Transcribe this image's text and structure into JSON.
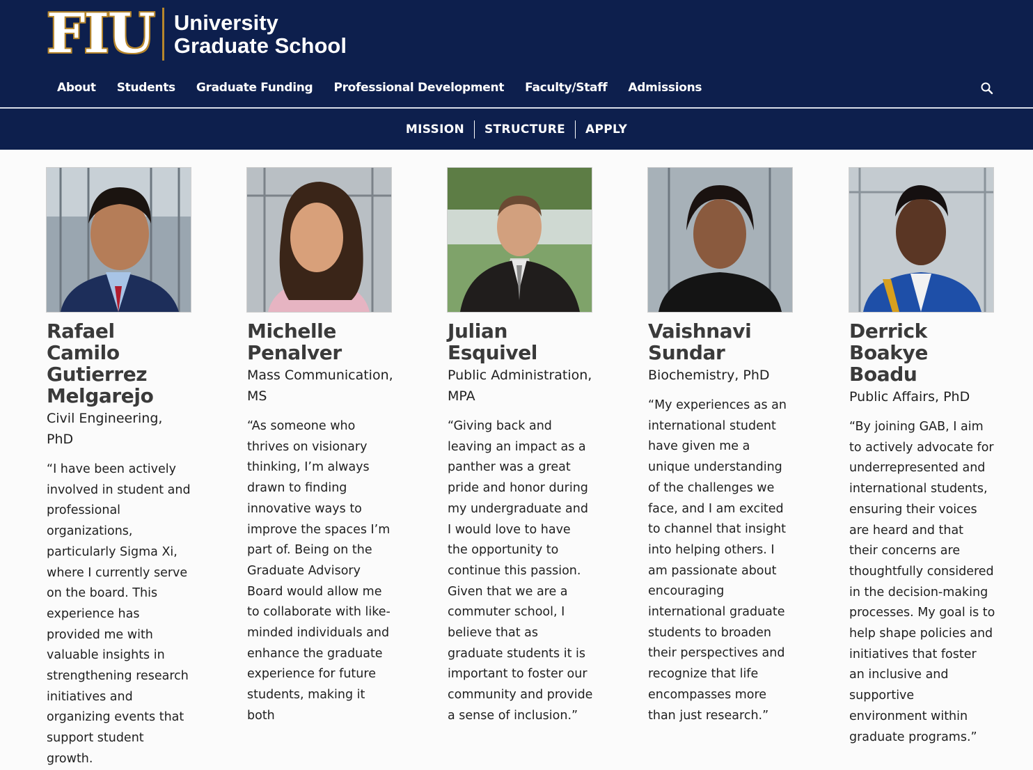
{
  "header": {
    "logo_mark": "FIU",
    "logo_line1": "University",
    "logo_line2": "Graduate School",
    "nav": [
      "About",
      "Students",
      "Graduate Funding",
      "Professional Development",
      "Faculty/Staff",
      "Admissions"
    ],
    "search_icon": "search-icon"
  },
  "subnav": [
    "MISSION",
    "STRUCTURE",
    "APPLY"
  ],
  "colors": {
    "navy": "#0d1f4d",
    "gold": "#b6862c"
  },
  "members": [
    {
      "name": "Rafael Camilo Gutierrez Melgarejo",
      "program": "Civil Engineering, PhD",
      "quote": "“I have been actively involved in student and professional organizations, particularly Sigma Xi, where I currently serve on the board. This experience has provided me with valuable insights in strengthening research initiatives and organizing events that support student growth."
    },
    {
      "name": "Michelle Penalver",
      "program": "Mass Communication, MS",
      "quote": "“As someone who thrives on visionary thinking, I’m always drawn to finding innovative ways to improve the spaces I’m part of. Being on the Graduate Advisory Board would allow me to collaborate with like-minded individuals and enhance the graduate experience for future students, making it both"
    },
    {
      "name": "Julian Esquivel",
      "program": "Public Administration, MPA",
      "quote": "“Giving back and leaving an impact as a panther was a great pride and honor during my undergraduate and I would love to have the opportunity to continue this passion. Given that we are a commuter school, I believe that as graduate students it is important to foster our community and provide a sense of inclusion.”"
    },
    {
      "name": "Vaishnavi Sundar",
      "program": "Biochemistry, PhD",
      "quote": "“My experiences as an international student have given me a unique understanding of the challenges we face, and I am excited to channel that insight into helping others. I am passionate about encouraging international graduate students to broaden their perspectives and recognize that life encompasses more than just research.”"
    },
    {
      "name": "Derrick Boakye Boadu",
      "program": "Public Affairs, PhD",
      "quote": "“By joining GAB, I aim to actively advocate for underrepresented and international students, ensuring their voices are heard and that their concerns are thoughtfully considered in the decision-making processes. My goal is to help shape policies and initiatives that foster an inclusive and supportive environment within graduate programs.”"
    }
  ]
}
